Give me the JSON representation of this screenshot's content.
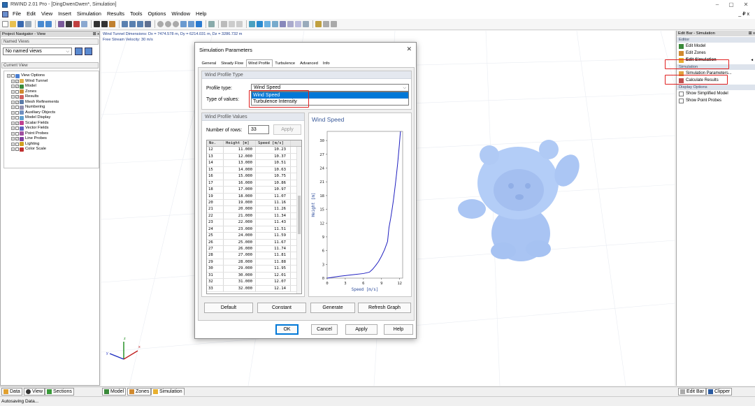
{
  "window": {
    "title": "RWIND 2.01 Pro - [DingDwenDwen*, Simulation]",
    "controls": [
      "–",
      "▢",
      "✕"
    ]
  },
  "menu": [
    "File",
    "Edit",
    "View",
    "Insert",
    "Simulation",
    "Results",
    "Tools",
    "Options",
    "Window",
    "Help"
  ],
  "menu_right": "_ ₽ x",
  "left_panel": {
    "title": "Project Navigator - View",
    "pin": "⊞ x",
    "named_views_header": "Named Views",
    "named_views_value": "No named views",
    "current_view_header": "Current View",
    "tree": [
      {
        "label": "View Options",
        "level": 0,
        "check": "",
        "icon": "#4a7ed1"
      },
      {
        "label": "Wind Tunnel",
        "level": 1,
        "check": "✓",
        "icon": "#e0b050"
      },
      {
        "label": "Model",
        "level": 1,
        "check": "✓",
        "icon": "#3a8a3a"
      },
      {
        "label": "Zones",
        "level": 1,
        "check": "",
        "icon": "#d08a30"
      },
      {
        "label": "Results",
        "level": 1,
        "check": "✓",
        "icon": "#d06060"
      },
      {
        "label": "Mesh Refinements",
        "level": 1,
        "check": "✓",
        "icon": "#5a7aa8"
      },
      {
        "label": "Numbering",
        "level": 1,
        "check": "",
        "icon": "#9090b0"
      },
      {
        "label": "Auxiliary Objects",
        "level": 1,
        "check": "",
        "icon": "#7090c0"
      },
      {
        "label": "Model Display",
        "level": 1,
        "check": "",
        "icon": "#60a0d0"
      },
      {
        "label": "Scalar Fields",
        "level": 1,
        "check": "✓",
        "icon": "#c04090"
      },
      {
        "label": "Vector Fields",
        "level": 1,
        "check": "",
        "icon": "#6060c0"
      },
      {
        "label": "Point Probes",
        "level": 1,
        "check": "",
        "icon": "#a050a0"
      },
      {
        "label": "Line Probes",
        "level": 1,
        "check": "✓",
        "icon": "#8040a0"
      },
      {
        "label": "Lighting",
        "level": 1,
        "check": "",
        "icon": "#d0a020"
      },
      {
        "label": "Color Scale",
        "level": 1,
        "check": "",
        "icon": "#c03030"
      }
    ]
  },
  "viewport": {
    "info_line1": "Wind Tunnel Dimensions: Dx = 7474.578 m, Dy = 6214.031 m, Dz = 3286.732 m",
    "info_line2": "Free Stream Velocity: 30 m/s",
    "axis_x": "x",
    "axis_y": "y",
    "axis_z": "z"
  },
  "right_panel": {
    "title": "Edit Bar - Simulation",
    "pin": "⊞ x",
    "sections": [
      {
        "title": "Editor",
        "items": [
          {
            "label": "Edit Model",
            "bold": false
          },
          {
            "label": "Edit Zones",
            "bold": false
          },
          {
            "label": "Edit Simulation",
            "bold": true
          }
        ]
      },
      {
        "title": "Simulation",
        "items": [
          {
            "label": "Simulation Parameters...",
            "bold": false
          },
          {
            "label": "Calculate Results",
            "bold": false
          }
        ]
      },
      {
        "title": "Display Options",
        "items": [
          {
            "label": "Show Simplified Model",
            "bold": false
          },
          {
            "label": "Show Point Probes",
            "bold": false
          }
        ]
      }
    ]
  },
  "bottom_tabs_left": [
    "Data",
    "View",
    "Sections"
  ],
  "bottom_tabs_mid": [
    "Model",
    "Zones",
    "Simulation"
  ],
  "bottom_tabs_right": [
    "Edit Bar",
    "Clipper"
  ],
  "status": "Autosaving Data...",
  "dialog": {
    "title": "Simulation Parameters",
    "close": "✕",
    "tabs": [
      "General",
      "Steady Flow",
      "Wind Profile",
      "Turbulence",
      "Advanced",
      "Info"
    ],
    "active_tab": "Wind Profile",
    "wind_profile_type": {
      "header": "Wind Profile Type",
      "profile_type_label": "Profile type:",
      "profile_type_value": "Wind Speed",
      "type_of_values_label": "Type of values:",
      "dropdown_options": [
        "Wind Speed",
        "Turbulence Intensity"
      ],
      "dropdown_selected": "Wind Speed"
    },
    "wind_profile_values": {
      "header": "Wind Profile Values",
      "rows_label": "Number of rows:",
      "rows_value": "33",
      "apply": "Apply",
      "columns": [
        "No.",
        "Height [m]",
        "Speed [m/s]"
      ],
      "rows": [
        [
          "12",
          "11.000",
          "10.23"
        ],
        [
          "13",
          "12.000",
          "10.37"
        ],
        [
          "14",
          "13.000",
          "10.51"
        ],
        [
          "15",
          "14.000",
          "10.63"
        ],
        [
          "16",
          "15.000",
          "10.75"
        ],
        [
          "17",
          "16.000",
          "10.86"
        ],
        [
          "18",
          "17.000",
          "10.97"
        ],
        [
          "19",
          "18.000",
          "11.07"
        ],
        [
          "20",
          "19.000",
          "11.16"
        ],
        [
          "21",
          "20.000",
          "11.26"
        ],
        [
          "22",
          "21.000",
          "11.34"
        ],
        [
          "23",
          "22.000",
          "11.43"
        ],
        [
          "24",
          "23.000",
          "11.51"
        ],
        [
          "25",
          "24.000",
          "11.59"
        ],
        [
          "26",
          "25.000",
          "11.67"
        ],
        [
          "27",
          "26.000",
          "11.74"
        ],
        [
          "28",
          "27.000",
          "11.81"
        ],
        [
          "29",
          "28.000",
          "11.88"
        ],
        [
          "30",
          "29.000",
          "11.95"
        ],
        [
          "31",
          "30.000",
          "12.01"
        ],
        [
          "32",
          "31.000",
          "12.07"
        ],
        [
          "33",
          "32.000",
          "12.14"
        ]
      ]
    },
    "graph": {
      "title": "Wind Speed",
      "xlabel": "Speed [m/s]",
      "ylabel": "Height [m]",
      "xticks": [
        "0",
        "3",
        "6",
        "9",
        "12"
      ],
      "yticks": [
        "0",
        "3",
        "6",
        "9",
        "12",
        "15",
        "18",
        "21",
        "24",
        "27",
        "30"
      ]
    },
    "action_buttons": [
      "Default",
      "Constant",
      "Generate",
      "Refresh Graph"
    ],
    "footer_buttons": [
      "OK",
      "Cancel",
      "Apply",
      "Help"
    ]
  },
  "chart_data": {
    "type": "line",
    "title": "Wind Speed",
    "xlabel": "Speed [m/s]",
    "ylabel": "Height [m]",
    "xlim": [
      0,
      12.5
    ],
    "ylim": [
      0,
      32
    ],
    "series": [
      {
        "x": [
          0,
          2,
          4,
          6,
          7.0,
          7.5,
          8.0,
          8.5,
          9.0,
          9.5,
          10.0,
          10.23,
          10.51,
          10.75,
          10.97,
          11.16,
          11.34,
          11.51,
          11.67,
          11.81,
          11.95,
          12.07,
          12.14
        ],
        "y": [
          0.0,
          0.4,
          0.7,
          1.0,
          1.3,
          1.9,
          2.7,
          3.6,
          4.8,
          6.2,
          8.0,
          11,
          13,
          15,
          17,
          19,
          21,
          23,
          25,
          27,
          29,
          31,
          32
        ]
      }
    ],
    "color": "#2020c0"
  }
}
